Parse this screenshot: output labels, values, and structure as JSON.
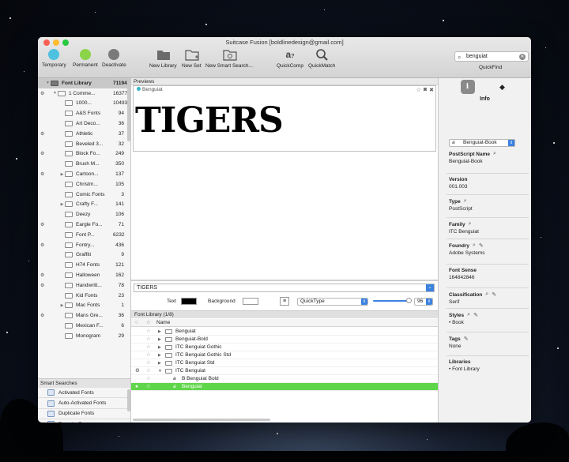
{
  "window": {
    "title": "Suitcase Fusion [boldlinedesign@gmail.com]"
  },
  "toolbar": {
    "temporary": "Temporary",
    "permanent": "Permanent",
    "deactivate": "Deactivate",
    "new_library": "New Library",
    "new_set": "New Set",
    "new_smart_search": "New Smart Search...",
    "quickcomp": "QuickComp",
    "quickmatch": "QuickMatch",
    "search_value": "benguiat",
    "quickfind": "QuickFind",
    "colors": {
      "temporary": "#4fc1e0",
      "permanent": "#8bd44a",
      "deactivate": "#7a7a7a"
    }
  },
  "sidebar": {
    "library": {
      "name": "Font Library",
      "count": "71194"
    },
    "commercial": {
      "name": "1 Comme...",
      "count": "16377"
    },
    "items": [
      {
        "name": "1000...",
        "count": "10493"
      },
      {
        "name": "A&S Fonts",
        "count": "94"
      },
      {
        "name": "Art Deco...",
        "count": "36"
      },
      {
        "name": "Athletic",
        "count": "37"
      },
      {
        "name": "Beveled 3...",
        "count": "32"
      },
      {
        "name": "Block Fo...",
        "count": "249"
      },
      {
        "name": "Brush M...",
        "count": "350"
      },
      {
        "name": "Cartoon...",
        "count": "137"
      },
      {
        "name": "Christm...",
        "count": "105"
      },
      {
        "name": "Comic Fonts",
        "count": "3"
      },
      {
        "name": "Crafty F...",
        "count": "141"
      },
      {
        "name": "Deezy",
        "count": "106"
      },
      {
        "name": "Eargle Fo...",
        "count": "71"
      },
      {
        "name": "Font P...",
        "count": "6232"
      },
      {
        "name": "Fontry...",
        "count": "436"
      },
      {
        "name": "Graffiti",
        "count": "9"
      },
      {
        "name": "H74 Fonts",
        "count": "121"
      },
      {
        "name": "Halloween",
        "count": "162"
      },
      {
        "name": "Handwritt...",
        "count": "78"
      },
      {
        "name": "Kid Fonts",
        "count": "23"
      },
      {
        "name": "Mac Fonts",
        "count": "1"
      },
      {
        "name": "Mans Gre...",
        "count": "36"
      },
      {
        "name": "Mexican F...",
        "count": "6"
      },
      {
        "name": "Monogram",
        "count": "29"
      }
    ],
    "smart_searches_title": "Smart Searches",
    "smart_searches": [
      "Activated Fonts",
      "Auto-Activated Fonts",
      "Duplicate Fonts",
      "Favorite Fonts",
      "Recently Added Fonts",
      "Untitled Smart Search"
    ]
  },
  "preview": {
    "title": "Previews",
    "font_name": "Benguiat",
    "sample": "TIGERS",
    "text_input": "TIGERS",
    "text_label": "Text",
    "background_label": "Background",
    "mode": "QuickType",
    "size": "96"
  },
  "fontlist": {
    "header": "Font Library (1/8)",
    "col_name": "Name",
    "rows": [
      {
        "name": "Benguiat"
      },
      {
        "name": "Benguiat-Bold"
      },
      {
        "name": "ITC Benguiat Gothic"
      },
      {
        "name": "ITC Benguiat Gothic Std"
      },
      {
        "name": "ITC Benguiat Std"
      },
      {
        "name": "ITC Benguiat"
      },
      {
        "name": "B Benguiat Bold"
      },
      {
        "name": "Benguiat"
      }
    ]
  },
  "info": {
    "title": "Info",
    "font_select": "Benguiat-Book",
    "fields": [
      {
        "label": "PostScript Name",
        "value": "Benguiat-Book"
      },
      {
        "label": "Version",
        "value": "001.003"
      },
      {
        "label": "Type",
        "value": "PostScript"
      },
      {
        "label": "Family",
        "value": "ITC Benguiat"
      },
      {
        "label": "Foundry",
        "value": "Adobe Systems"
      },
      {
        "label": "Font Sense",
        "value": "164842846"
      },
      {
        "label": "Classification",
        "value": "Serif"
      },
      {
        "label": "Styles",
        "value": "• Book"
      },
      {
        "label": "Tags",
        "value": "None"
      },
      {
        "label": "Libraries",
        "value": "• Font Library"
      }
    ]
  }
}
